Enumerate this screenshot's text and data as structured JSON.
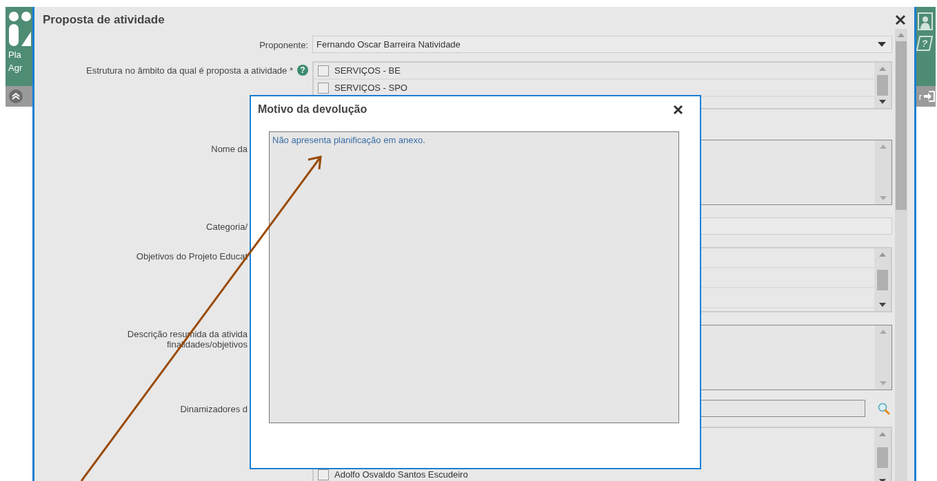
{
  "app": {
    "header_left": [
      "Pla",
      "Agr"
    ],
    "help_icon": "?",
    "toolbar_right": "r"
  },
  "dialog": {
    "title": "Proposta de atividade",
    "fields": [
      {
        "kind": "select",
        "label": "Proponente:",
        "value": "Fernando Oscar Barreira Natividade"
      },
      {
        "kind": "checklist",
        "label": "Estrutura no âmbito da qual é proposta a atividade *",
        "help": "?",
        "items": [
          {
            "label": "SERVIÇOS - BE",
            "checked": false
          },
          {
            "label": "SERVIÇOS - SPO",
            "checked": false
          }
        ]
      },
      {
        "kind": "textarea",
        "label": "Nome da"
      },
      {
        "kind": "select",
        "label": "Categoria/"
      },
      {
        "kind": "list",
        "label": "Objetivos do Projeto Educat"
      },
      {
        "kind": "textarea",
        "label": "Descrição resumida da ativida\nfinalidades/objetivos"
      },
      {
        "kind": "search",
        "label": "Dinamizadores d"
      },
      {
        "kind": "checklist",
        "items": [
          {
            "label": "Adolfo Osvaldo Santos Escudeiro",
            "checked": false
          }
        ]
      }
    ]
  },
  "modal": {
    "title": "Motivo da devolução",
    "value": "Não apresenta planificação em anexo."
  }
}
